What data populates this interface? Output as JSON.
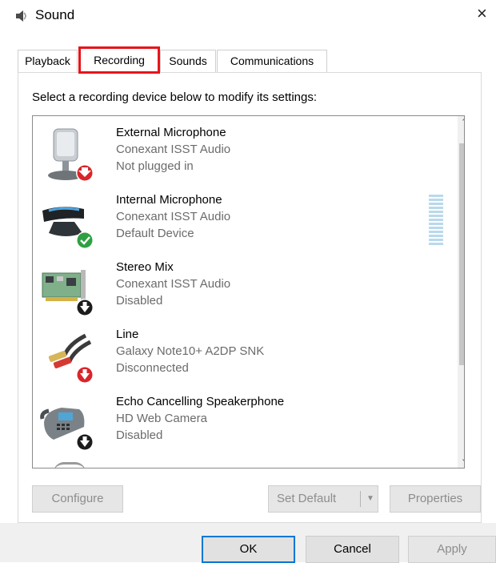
{
  "window": {
    "title": "Sound",
    "close_glyph": "×"
  },
  "tabs": [
    {
      "label": "Playback"
    },
    {
      "label": "Recording",
      "selected": true
    },
    {
      "label": "Sounds"
    },
    {
      "label": "Communications"
    }
  ],
  "instruction": "Select a recording device below to modify its settings:",
  "devices": [
    {
      "name": "External Microphone",
      "driver": "Conexant ISST Audio",
      "status": "Not plugged in",
      "icon": "microphone-icon",
      "badge": "red-down-arrow"
    },
    {
      "name": "Internal Microphone",
      "driver": "Conexant ISST Audio",
      "status": "Default Device",
      "icon": "webcam-microphone-icon",
      "badge": "green-check",
      "level_meter": true
    },
    {
      "name": "Stereo Mix",
      "driver": "Conexant ISST Audio",
      "status": "Disabled",
      "icon": "sound-card-icon",
      "badge": "black-down-arrow"
    },
    {
      "name": "Line",
      "driver": "Galaxy Note10+ A2DP SNK",
      "status": "Disconnected",
      "icon": "rca-cable-icon",
      "badge": "red-down-arrow"
    },
    {
      "name": "Echo Cancelling Speakerphone",
      "driver": "HD Web Camera",
      "status": "Disabled",
      "icon": "speakerphone-icon",
      "badge": "black-down-arrow"
    }
  ],
  "buttons": {
    "configure": "Configure",
    "set_default": "Set Default",
    "properties": "Properties",
    "ok": "OK",
    "cancel": "Cancel",
    "apply": "Apply"
  },
  "colors": {
    "highlight": "#e8141a",
    "focus": "#0078d7",
    "status_green": "#2ea043",
    "status_red": "#d9252a"
  }
}
